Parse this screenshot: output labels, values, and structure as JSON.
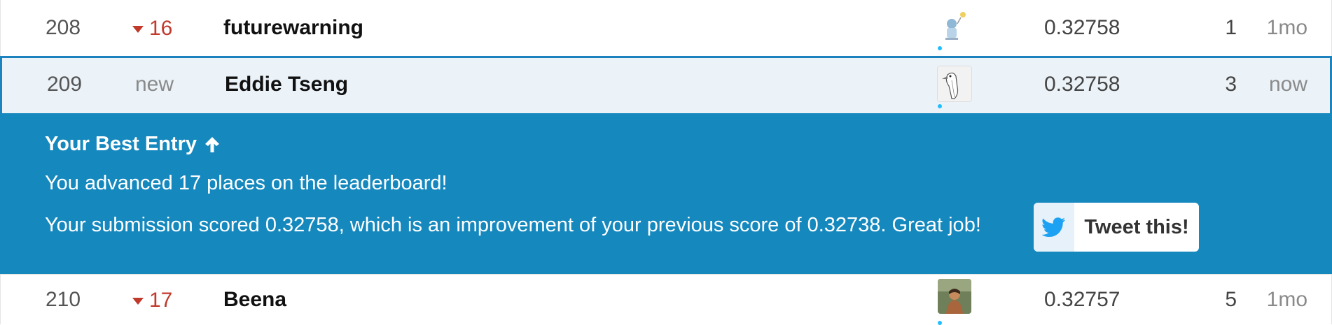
{
  "rows": [
    {
      "rank": "208",
      "change": "16",
      "team": "futurewarning",
      "score": "0.32758",
      "entries": "1",
      "last": "1mo"
    },
    {
      "rank": "209",
      "change": "new",
      "team": "Eddie Tseng",
      "score": "0.32758",
      "entries": "3",
      "last": "now"
    },
    {
      "rank": "210",
      "change": "17",
      "team": "Beena",
      "score": "0.32757",
      "entries": "5",
      "last": "1mo"
    }
  ],
  "banner": {
    "title": "Your Best Entry",
    "advanced": "You advanced 17 places on the leaderboard!",
    "submission": "Your submission scored 0.32758, which is an improvement of your previous score of 0.32738. Great job!",
    "tweet_label": "Tweet this!"
  },
  "colors": {
    "banner_bg": "#1588be",
    "highlight_border": "#1c83bf",
    "down_red": "#c0392b",
    "twitter_blue": "#1da1f2",
    "online_dot": "#20beff"
  },
  "icons": {
    "change_down": "triangle-down-icon",
    "title_arrow": "arrow-up-icon",
    "tweet": "twitter-bird-icon"
  }
}
